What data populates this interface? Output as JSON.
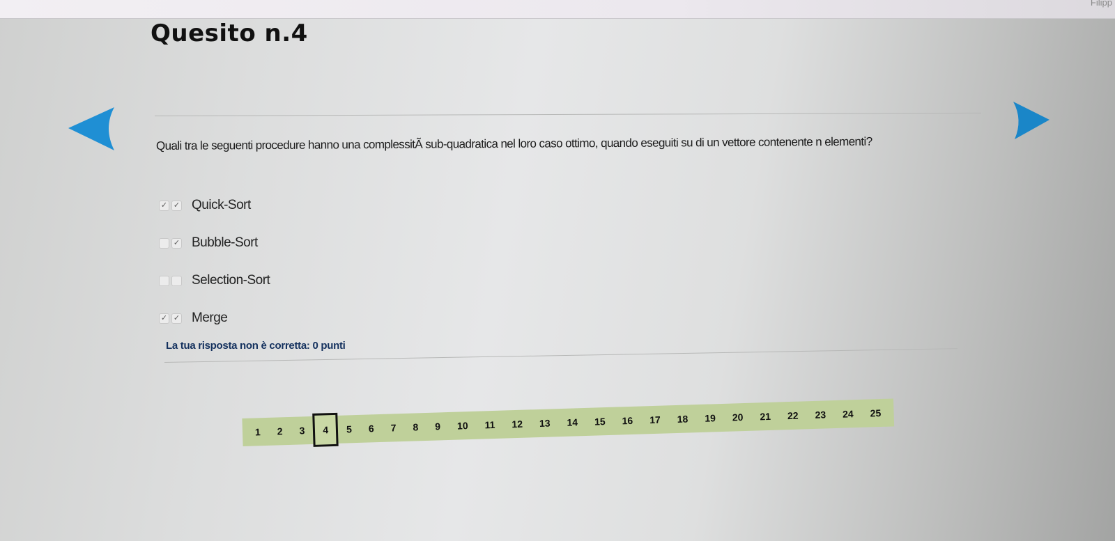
{
  "window": {
    "user_label": "Filipp"
  },
  "quiz": {
    "title": "Quesito n.4",
    "question": "Quali tra le seguenti procedure hanno una complessitÃ  sub-quadratica nel loro caso ottimo, quando eseguiti su di un vettore contenente n elementi?",
    "answers": [
      {
        "label": "Quick-Sort",
        "box1": "✓",
        "box2": "✓"
      },
      {
        "label": "Bubble-Sort",
        "box1": "",
        "box2": "✓"
      },
      {
        "label": "Selection-Sort",
        "box1": "",
        "box2": ""
      },
      {
        "label": "Merge",
        "box1": "✓",
        "box2": "✓"
      }
    ],
    "result": "La tua risposta non è corretta: 0 punti"
  },
  "navigation": {
    "prev_icon": "triangle-left-icon",
    "next_icon": "triangle-right-icon",
    "accent_color": "#1f8fd4"
  },
  "pager": {
    "current": "4",
    "pages": [
      "1",
      "2",
      "3",
      "4",
      "5",
      "6",
      "7",
      "8",
      "9",
      "10",
      "11",
      "12",
      "13",
      "14",
      "15",
      "16",
      "17",
      "18",
      "19",
      "20",
      "21",
      "22",
      "23",
      "24",
      "25"
    ],
    "background_color": "#bfd09a"
  }
}
